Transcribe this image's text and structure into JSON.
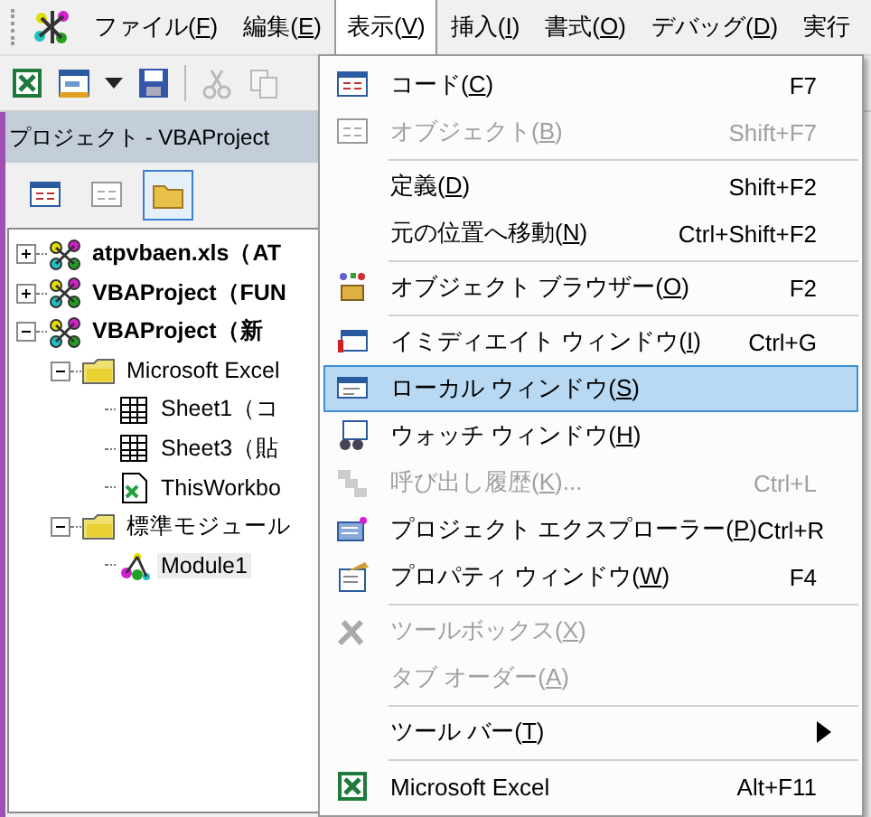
{
  "menubar": [
    {
      "label": "ファイル(",
      "mnemonic": "F",
      "suffix": ")",
      "selected": false
    },
    {
      "label": "編集(",
      "mnemonic": "E",
      "suffix": ")",
      "selected": false
    },
    {
      "label": "表示(",
      "mnemonic": "V",
      "suffix": ")",
      "selected": true
    },
    {
      "label": "挿入(",
      "mnemonic": "I",
      "suffix": ")",
      "selected": false
    },
    {
      "label": "書式(",
      "mnemonic": "O",
      "suffix": ")",
      "selected": false
    },
    {
      "label": "デバッグ(",
      "mnemonic": "D",
      "suffix": ")",
      "selected": false
    },
    {
      "label": "実行",
      "selected": false
    }
  ],
  "toolbar": [
    {
      "disabled": false
    },
    {
      "disabled": false
    },
    {
      "disabled": false
    },
    {
      "disabled": true
    },
    {
      "disabled": true
    }
  ],
  "project_pane": {
    "title": "プロジェクト - VBAProject",
    "tools": [
      {
        "selected": false
      },
      {
        "selected": false
      },
      {
        "selected": true
      }
    ],
    "tree": [
      {
        "label": "atpvbaen.xls（AT",
        "kind": "project",
        "expanded": false,
        "selected": false
      },
      {
        "label": "VBAProject（FUN",
        "kind": "project",
        "expanded": false,
        "selected": false
      },
      {
        "label": "VBAProject（新",
        "kind": "project",
        "expanded": true,
        "selected": false,
        "children": [
          {
            "label": "Microsoft Excel",
            "kind": "folder",
            "expanded": true,
            "selected": false,
            "children": [
              {
                "label": "Sheet1（コ",
                "kind": "sheet",
                "selected": false
              },
              {
                "label": "Sheet3（貼",
                "kind": "sheet",
                "selected": false
              },
              {
                "label": "ThisWorkbo",
                "kind": "workbook",
                "selected": false
              }
            ]
          },
          {
            "label": "標準モジュール",
            "kind": "folder",
            "expanded": true,
            "selected": false,
            "children": [
              {
                "label": "Module1",
                "kind": "module",
                "selected": true
              }
            ]
          }
        ]
      }
    ]
  },
  "view_menu": [
    {
      "kind": "item",
      "label": "コード(",
      "mnemonic": "C",
      "suffix": ")",
      "shortcut": "F7",
      "disabled": false,
      "selected": false
    },
    {
      "kind": "item",
      "label": "オブジェクト(",
      "mnemonic": "B",
      "suffix": ")",
      "shortcut": "Shift+F7",
      "disabled": true,
      "selected": false
    },
    {
      "kind": "separator"
    },
    {
      "kind": "item",
      "label": "定義(",
      "mnemonic": "D",
      "suffix": ")",
      "shortcut": "Shift+F2",
      "disabled": false,
      "selected": false
    },
    {
      "kind": "item",
      "label": "元の位置へ移動(",
      "mnemonic": "N",
      "suffix": ")",
      "shortcut": "Ctrl+Shift+F2",
      "disabled": false,
      "selected": false
    },
    {
      "kind": "separator"
    },
    {
      "kind": "item",
      "label": "オブジェクト ブラウザー(",
      "mnemonic": "O",
      "suffix": ")",
      "shortcut": "F2",
      "disabled": false,
      "selected": false
    },
    {
      "kind": "separator"
    },
    {
      "kind": "item",
      "label": "イミディエイト ウィンドウ(",
      "mnemonic": "I",
      "suffix": ")",
      "shortcut": "Ctrl+G",
      "disabled": false,
      "selected": false
    },
    {
      "kind": "item",
      "label": "ローカル ウィンドウ(",
      "mnemonic": "S",
      "suffix": ")",
      "disabled": false,
      "selected": true
    },
    {
      "kind": "item",
      "label": "ウォッチ ウィンドウ(",
      "mnemonic": "H",
      "suffix": ")",
      "disabled": false,
      "selected": false
    },
    {
      "kind": "item",
      "label": "呼び出し履歴(",
      "mnemonic": "K",
      "suffix": ")...",
      "shortcut": "Ctrl+L",
      "disabled": true,
      "selected": false
    },
    {
      "kind": "item",
      "label": "プロジェクト エクスプローラー(",
      "mnemonic": "P",
      "suffix": ")",
      "shortcut": "Ctrl+R",
      "disabled": false,
      "selected": false
    },
    {
      "kind": "item",
      "label": "プロパティ ウィンドウ(",
      "mnemonic": "W",
      "suffix": ")",
      "shortcut": "F4",
      "disabled": false,
      "selected": false
    },
    {
      "kind": "separator"
    },
    {
      "kind": "item",
      "label": "ツールボックス(",
      "mnemonic": "X",
      "suffix": ")",
      "disabled": true,
      "selected": false
    },
    {
      "kind": "item",
      "label": "タブ オーダー(",
      "mnemonic": "A",
      "suffix": ")",
      "disabled": true,
      "selected": false
    },
    {
      "kind": "separator"
    },
    {
      "kind": "item",
      "label": "ツール バー(",
      "mnemonic": "T",
      "suffix": ")",
      "submenu": true,
      "disabled": false,
      "selected": false
    },
    {
      "kind": "separator"
    },
    {
      "kind": "item",
      "label": "Microsoft Excel",
      "shortcut": "Alt+F11",
      "disabled": false,
      "selected": false
    }
  ]
}
